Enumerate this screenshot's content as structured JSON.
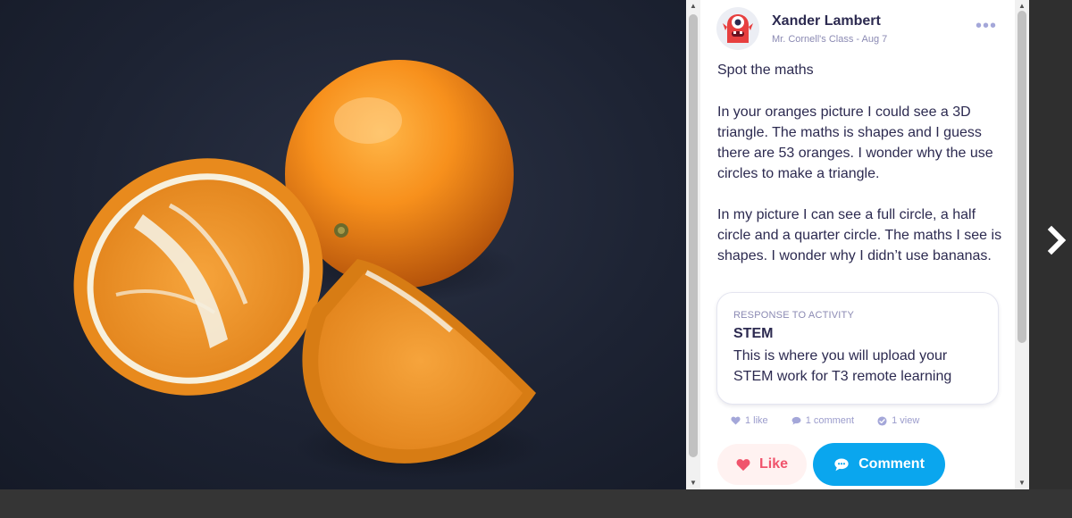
{
  "post": {
    "author": "Xander Lambert",
    "meta": "Mr. Cornell's Class - Aug 7",
    "title": "Spot the maths",
    "paragraph1": "In your oranges picture I could see a 3D triangle.  The maths is shapes and I guess there are 53 oranges.  I wonder why the use circles to make a triangle.",
    "paragraph2": "In my picture I can see a full circle, a half circle and a quarter circle.  The maths I see is shapes.  I wonder why I didn’t use bananas."
  },
  "activity": {
    "label": "RESPONSE TO ACTIVITY",
    "name": "STEM",
    "description": "This is where you will upload your STEM work for T3 remote learning"
  },
  "stats": {
    "likes": "1 like",
    "comments": "1 comment",
    "views": "1 view"
  },
  "actions": {
    "like_label": "Like",
    "comment_label": "Comment"
  },
  "icons": [
    "more-icon",
    "heart-icon",
    "comment-icon",
    "check-circle-icon",
    "chevron-right-icon",
    "monster-avatar"
  ],
  "colors": {
    "accent_blue": "#0aa6ee",
    "like_red": "#f0546c",
    "text_dark": "#2c2a50",
    "text_muted": "#8b8ab3"
  }
}
